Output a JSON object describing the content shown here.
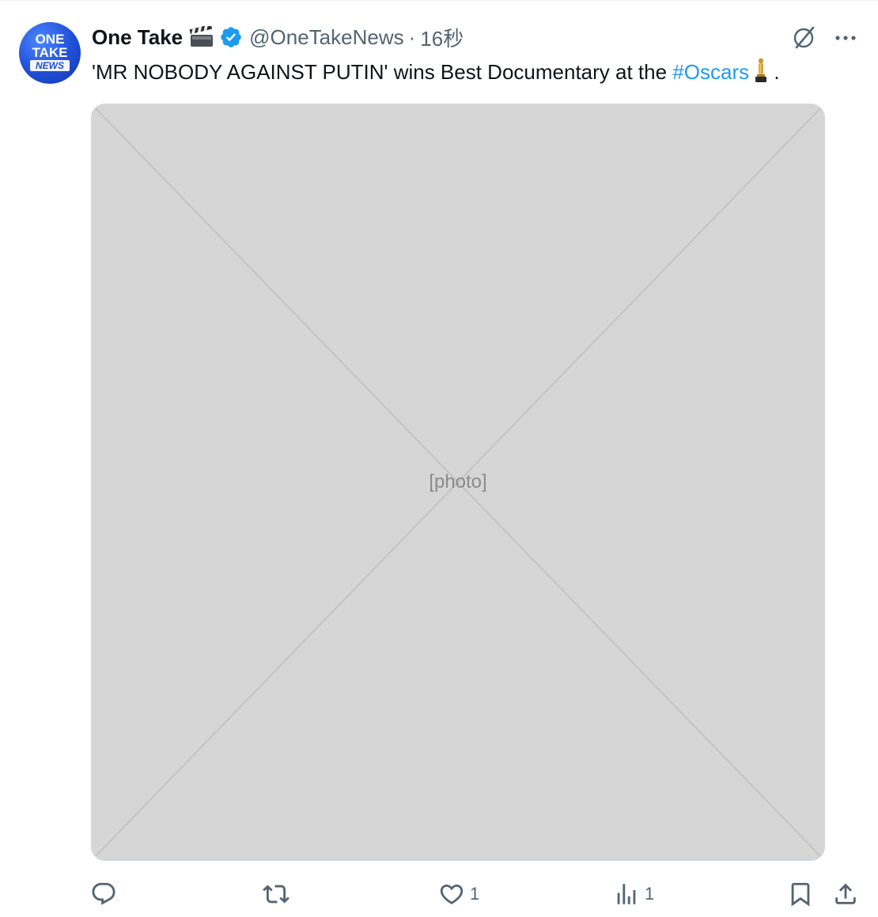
{
  "tweet": {
    "author": {
      "display_name": "One Take",
      "handle": "@OneTakeNews",
      "separator": "·",
      "time": "16秒",
      "avatar_text": [
        "ONE",
        "TAKE",
        "NEWS"
      ]
    },
    "text_before": "'MR NOBODY AGAINST PUTIN' wins Best Documentary at the ",
    "hashtag": "#Oscars",
    "text_after": " .",
    "media": {
      "description": "[photo]"
    },
    "actions": {
      "reply_count": "",
      "retweet_count": "",
      "like_count": "1",
      "views_count": "1"
    }
  },
  "colors": {
    "text_primary": "#0f1419",
    "text_secondary": "#536471",
    "link": "#1d9bf0",
    "verified": "#1d9bf0",
    "avatar_bg": "#1f4fd8"
  },
  "icons": {
    "reply": "speech-bubble-icon",
    "retweet": "retweet-arrows-icon",
    "like": "heart-icon",
    "views": "bar-chart-icon",
    "bookmark": "bookmark-icon",
    "share": "share-upload-icon",
    "grok": "grok-slash-circle-icon",
    "more": "ellipsis-icon",
    "verified": "verified-badge-icon",
    "clapper": "clapperboard-emoji-icon",
    "oscar": "trophy-statue-emoji-icon"
  }
}
